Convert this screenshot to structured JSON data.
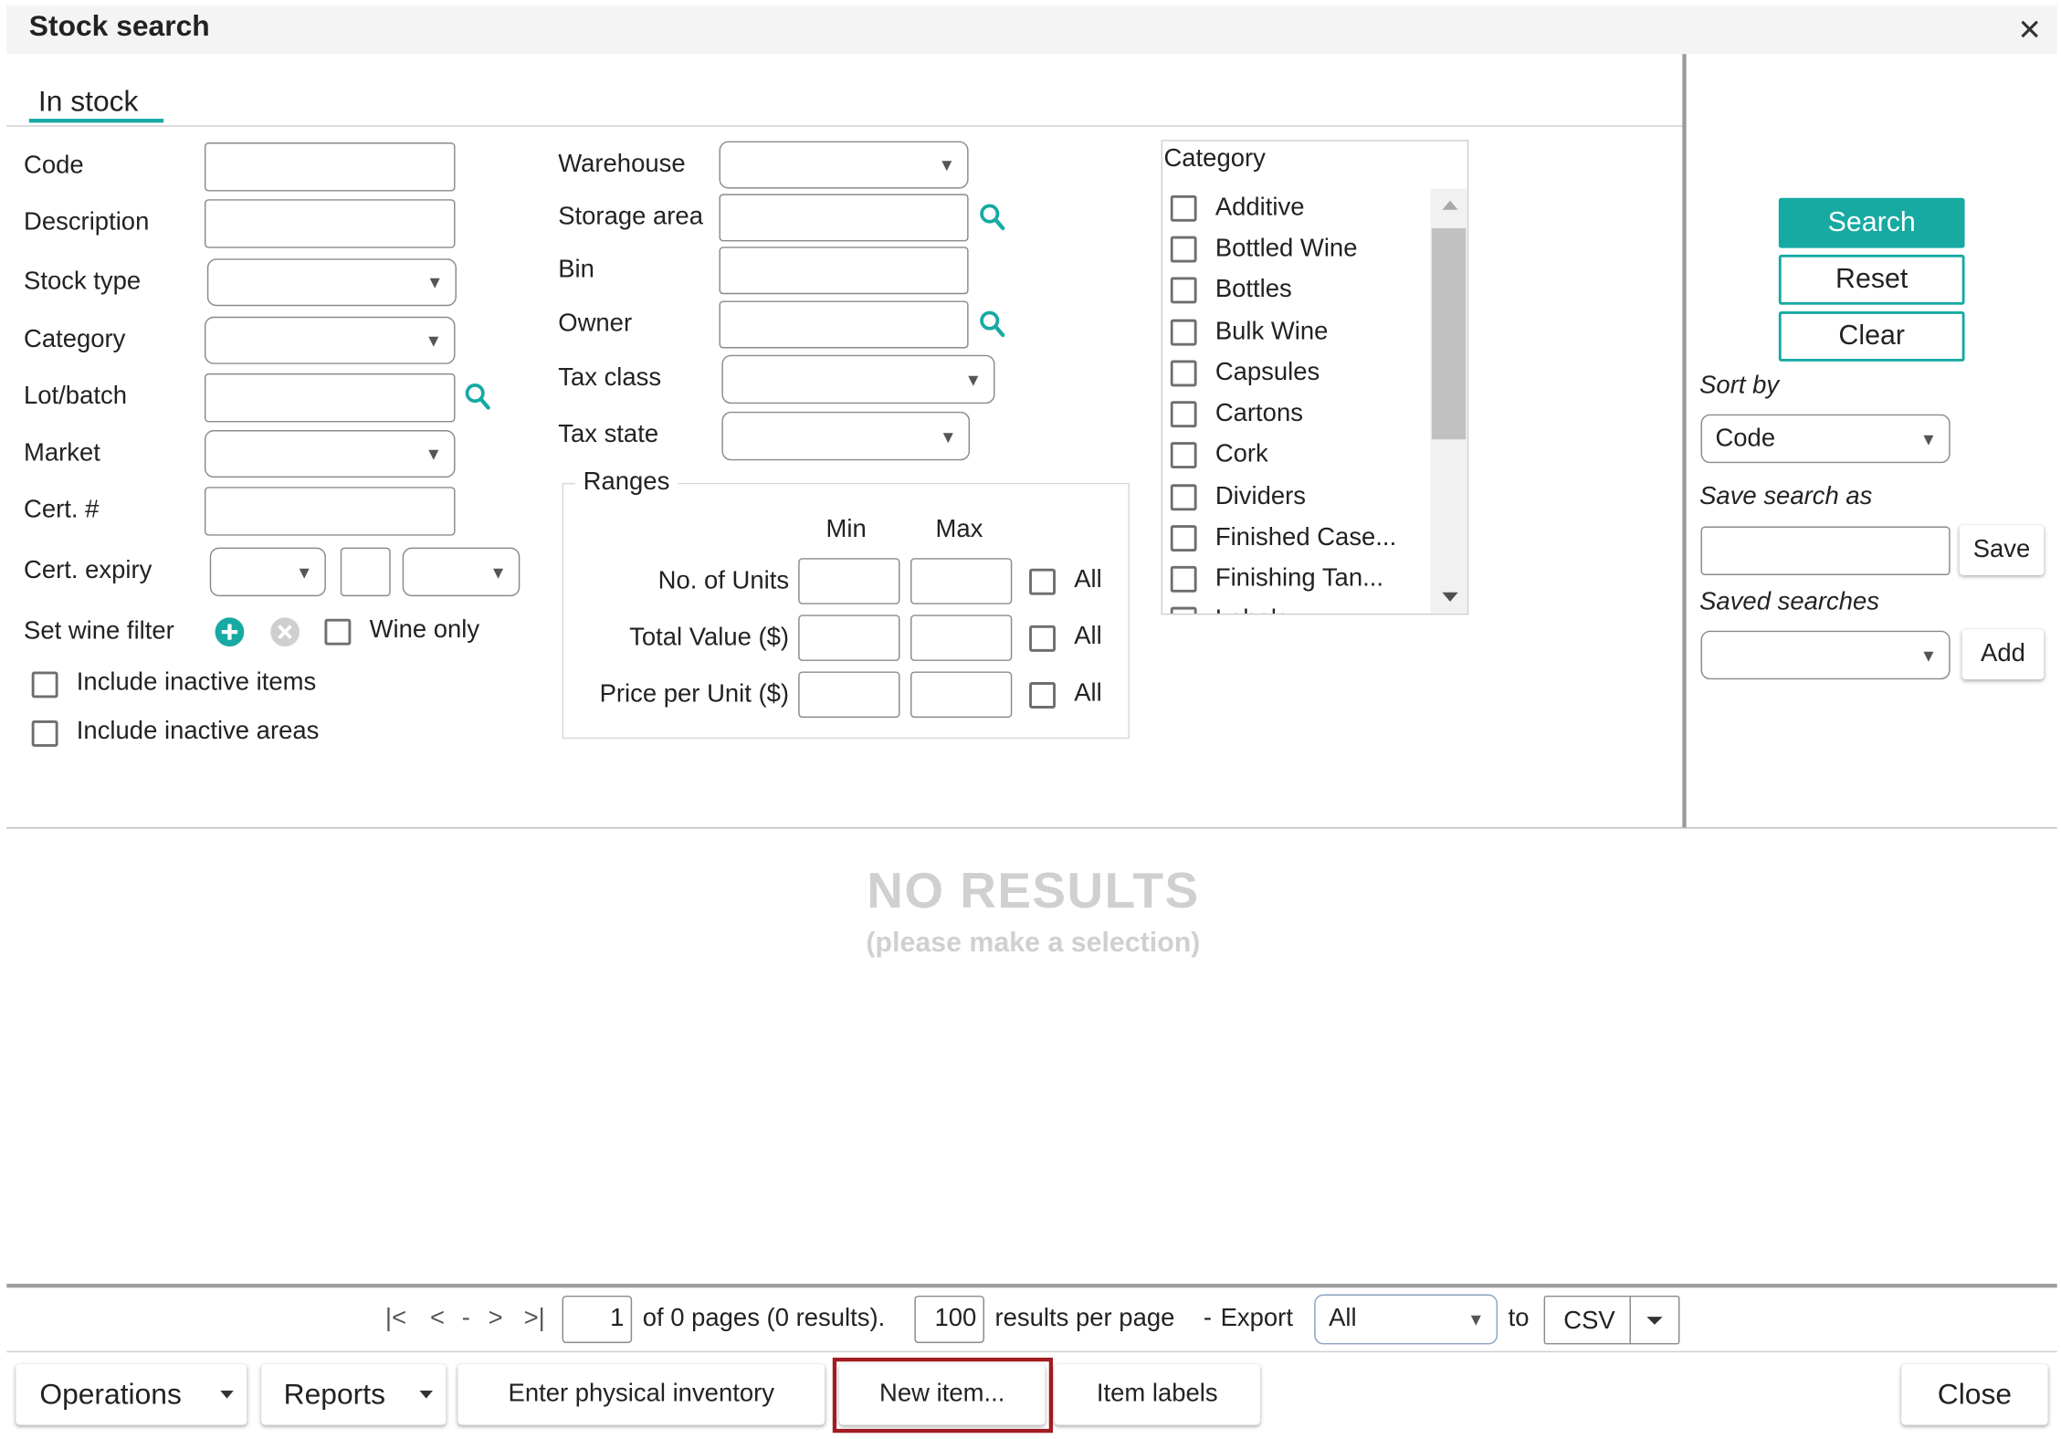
{
  "window": {
    "title": "Stock search",
    "close_glyph": "✕"
  },
  "tabs": [
    {
      "label": "In stock",
      "active": true
    }
  ],
  "form_left": {
    "code_label": "Code",
    "description_label": "Description",
    "stock_type_label": "Stock type",
    "category_label": "Category",
    "lot_batch_label": "Lot/batch",
    "market_label": "Market",
    "cert_no_label": "Cert. #",
    "cert_expiry_label": "Cert. expiry",
    "wine_filter_label": "Set wine filter",
    "wine_only_label": "Wine only",
    "include_inactive_items_label": "Include inactive items",
    "include_inactive_areas_label": "Include inactive areas"
  },
  "form_middle": {
    "warehouse_label": "Warehouse",
    "storage_area_label": "Storage area",
    "bin_label": "Bin",
    "owner_label": "Owner",
    "tax_class_label": "Tax class",
    "tax_state_label": "Tax state"
  },
  "ranges": {
    "legend": "Ranges",
    "min_header": "Min",
    "max_header": "Max",
    "rows": [
      {
        "label": "No. of Units",
        "all_label": "All"
      },
      {
        "label": "Total Value ($)",
        "all_label": "All"
      },
      {
        "label": "Price per Unit ($)",
        "all_label": "All"
      }
    ]
  },
  "category_list": {
    "title": "Category",
    "items": [
      "Additive",
      "Bottled Wine",
      "Bottles",
      "Bulk Wine",
      "Capsules",
      "Cartons",
      "Cork",
      "Dividers",
      "Finished Case...",
      "Finishing Tan...",
      "Labels"
    ]
  },
  "actions": {
    "search_label": "Search",
    "reset_label": "Reset",
    "clear_label": "Clear",
    "sort_by_label": "Sort by",
    "sort_by_value": "Code",
    "save_search_as_label": "Save search as",
    "save_button": "Save",
    "saved_searches_label": "Saved searches",
    "add_button": "Add"
  },
  "results": {
    "empty_title": "NO RESULTS",
    "empty_subtitle": "(please make a selection)"
  },
  "pagination": {
    "page_value": "1",
    "pages_text": "of 0 pages (0 results).",
    "per_page_value": "100",
    "per_page_text": "results per page",
    "separator": "-",
    "export_label": "Export",
    "export_value": "All",
    "to_label": "to",
    "format_value": "CSV",
    "nav_first": "|<",
    "nav_prev": "<",
    "nav_dash": "-",
    "nav_next": ">",
    "nav_last": ">|"
  },
  "footer": {
    "operations_label": "Operations",
    "reports_label": "Reports",
    "enter_inventory_label": "Enter physical inventory",
    "new_item_label": "New item...",
    "item_labels_label": "Item labels",
    "close_label": "Close"
  },
  "colors": {
    "accent": "#16aaa3",
    "highlight_border": "#a11c22",
    "title_bar": "#f4f4f4",
    "muted_text": "#d0d0d0"
  }
}
